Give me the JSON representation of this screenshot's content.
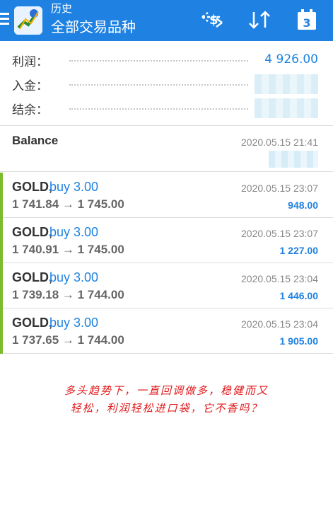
{
  "header": {
    "title": "历史",
    "subtitle": "全部交易品种",
    "calendar_day": "3",
    "accent": "#1f82e2"
  },
  "summary": {
    "profit_label": "利润：",
    "profit_value": "4 926.00",
    "deposit_label": "入金：",
    "balance_label": "结余："
  },
  "balance": {
    "label": "Balance",
    "time": "2020.05.15 21:41"
  },
  "trades": [
    {
      "symbol": "GOLD,",
      "side": "buy 3.00",
      "prices": "1 741.84 → 1 745.00",
      "time": "2020.05.15 23:07",
      "profit": "948.00"
    },
    {
      "symbol": "GOLD,",
      "side": "buy 3.00",
      "prices": "1 740.91 → 1 745.00",
      "time": "2020.05.15 23:07",
      "profit": "1 227.00"
    },
    {
      "symbol": "GOLD,",
      "side": "buy 3.00",
      "prices": "1 739.18 → 1 744.00",
      "time": "2020.05.15 23:04",
      "profit": "1 446.00"
    },
    {
      "symbol": "GOLD,",
      "side": "buy 3.00",
      "prices": "1 737.65 → 1 744.00",
      "time": "2020.05.15 23:04",
      "profit": "1 905.00"
    }
  ],
  "caption": {
    "line1": "多头趋势下，一直回调做多，稳健而又",
    "line2": "轻松，利润轻松进口袋，它不香吗？"
  }
}
